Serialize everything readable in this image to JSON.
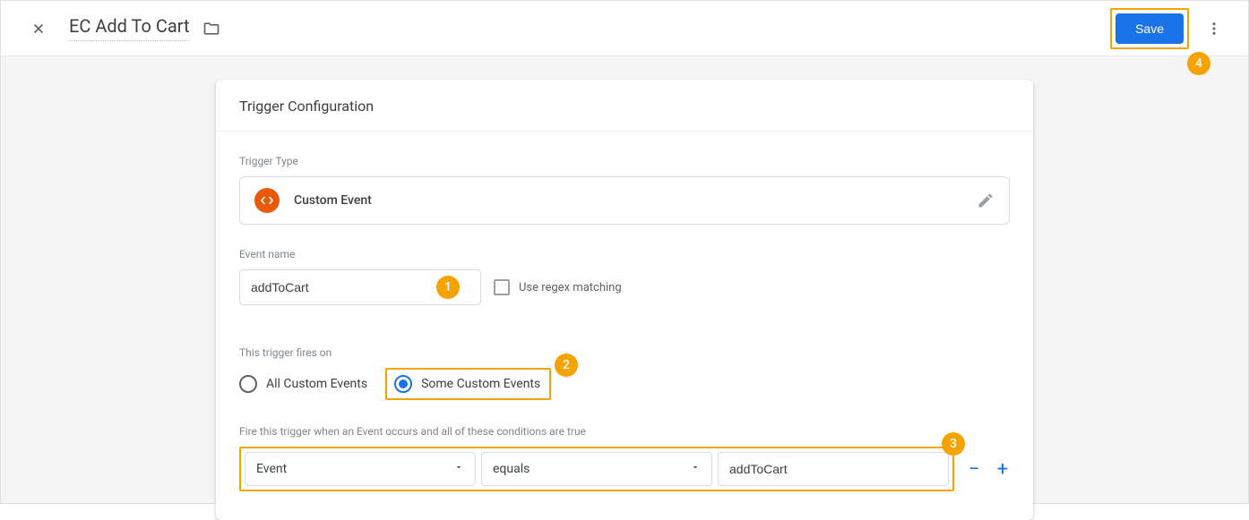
{
  "header": {
    "title": "EC Add To Cart",
    "save_label": "Save"
  },
  "card": {
    "title": "Trigger Configuration",
    "trigger_type_label": "Trigger Type",
    "trigger_type_name": "Custom Event",
    "event_name_label": "Event name",
    "event_name_value": "addToCart",
    "regex_label": "Use regex matching",
    "fires_on_label": "This trigger fires on",
    "radio_all": "All Custom Events",
    "radio_some": "Some Custom Events",
    "condition_label": "Fire this trigger when an Event occurs and all of these conditions are true",
    "cond_var": "Event",
    "cond_op": "equals",
    "cond_val": "addToCart"
  },
  "badges": {
    "b1": "1",
    "b2": "2",
    "b3": "3",
    "b4": "4"
  }
}
